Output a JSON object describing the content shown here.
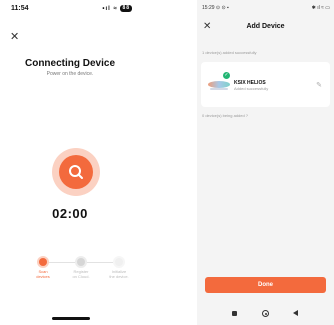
{
  "left_screen": {
    "status_bar": {
      "time": "11:54",
      "signal_text": "•ıl ≈",
      "battery": "88"
    },
    "close_label": "✕",
    "title": "Connecting Device",
    "subtitle": "Power on the device.",
    "timer": "02:00",
    "center_icon": "search-icon",
    "steps": [
      {
        "label_line1": "Scan",
        "label_line2": "devices"
      },
      {
        "label_line1": "Register",
        "label_line2": "on Cloud."
      },
      {
        "label_line1": "Initialize",
        "label_line2": "the device."
      }
    ]
  },
  "right_screen": {
    "status_bar": {
      "time": "15:29 ⊙ ⊙ ▪",
      "icons_text": "✱ ıl ≈ ▭"
    },
    "close_label": "✕",
    "title": "Add Device",
    "added_caption": "1 device(s) added successfully",
    "device": {
      "name": "KSIX HELIOS",
      "status": "Added successfully",
      "edit_icon": "pencil-icon"
    },
    "adding_caption": "0 device(s) being added ?",
    "done_label": "Done"
  },
  "colors": {
    "accent": "#f36a3d",
    "accent_light": "#fbd1c2",
    "success": "#22b573"
  }
}
